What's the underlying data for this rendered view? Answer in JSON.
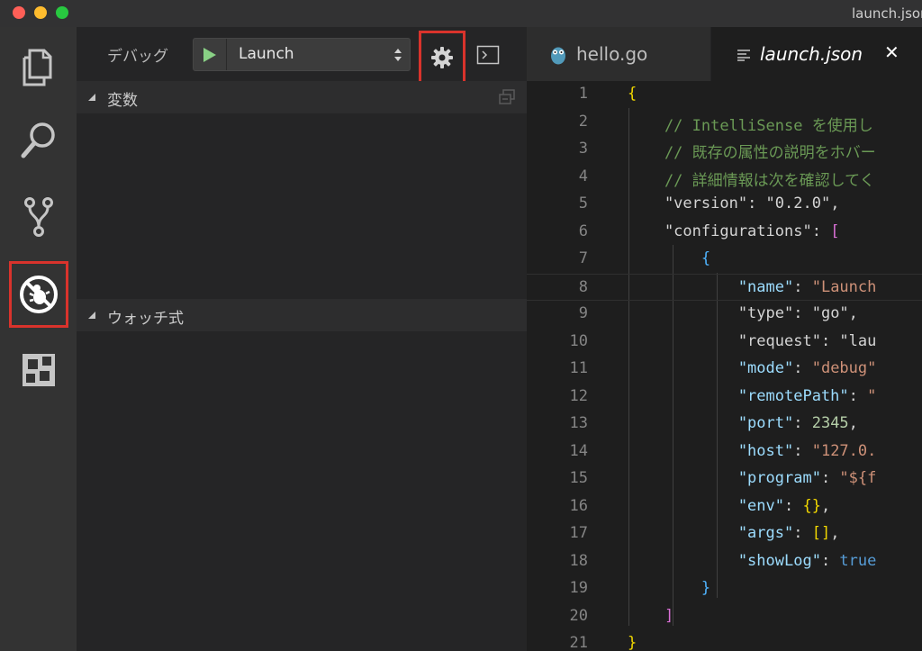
{
  "window": {
    "title": "launch.json"
  },
  "activity_bar": {
    "items": [
      {
        "name": "explorer-icon"
      },
      {
        "name": "search-icon"
      },
      {
        "name": "source-control-icon"
      },
      {
        "name": "debug-icon",
        "active": true
      },
      {
        "name": "extensions-icon"
      }
    ]
  },
  "debug_toolbar": {
    "label": "デバッグ",
    "config_value": "Launch"
  },
  "sections": {
    "variables": "変数",
    "watch": "ウォッチ式"
  },
  "tabs": [
    {
      "label": "hello.go"
    },
    {
      "label": "launch.json",
      "close": "✕"
    }
  ],
  "code_lines": [
    {
      "n": "1",
      "parts": [
        [
          "{",
          "c-brace1"
        ]
      ]
    },
    {
      "n": "2",
      "parts": [
        [
          "    // IntelliSense を使用し",
          "c-comment"
        ]
      ]
    },
    {
      "n": "3",
      "parts": [
        [
          "    // 既存の属性の説明をホバー",
          "c-comment"
        ]
      ]
    },
    {
      "n": "4",
      "parts": [
        [
          "    // 詳細情報は次を確認してく",
          "c-comment"
        ]
      ]
    },
    {
      "n": "5",
      "parts": [
        [
          "    \"version\"",
          "c-key2"
        ],
        [
          ": ",
          "c-punc"
        ],
        [
          "\"0.2.0\"",
          "c-key2"
        ],
        [
          ",",
          "c-punc"
        ]
      ]
    },
    {
      "n": "6",
      "parts": [
        [
          "    \"configurations\"",
          "c-key2"
        ],
        [
          ": ",
          "c-punc"
        ],
        [
          "[",
          "c-brace2"
        ]
      ]
    },
    {
      "n": "7",
      "parts": [
        [
          "        {",
          "c-brace3"
        ]
      ]
    },
    {
      "n": "8",
      "parts": [
        [
          "            \"name\"",
          "c-key"
        ],
        [
          ": ",
          "c-punc"
        ],
        [
          "\"Launch",
          "c-str"
        ]
      ]
    },
    {
      "n": "9",
      "parts": [
        [
          "            \"type\"",
          "c-key2"
        ],
        [
          ": ",
          "c-punc"
        ],
        [
          "\"go\"",
          "c-key2"
        ],
        [
          ",",
          "c-punc"
        ]
      ]
    },
    {
      "n": "10",
      "parts": [
        [
          "            \"request\"",
          "c-key2"
        ],
        [
          ": ",
          "c-punc"
        ],
        [
          "\"lau",
          "c-key2"
        ]
      ]
    },
    {
      "n": "11",
      "parts": [
        [
          "            \"mode\"",
          "c-key"
        ],
        [
          ": ",
          "c-punc"
        ],
        [
          "\"debug\"",
          "c-str"
        ]
      ]
    },
    {
      "n": "12",
      "parts": [
        [
          "            \"remotePath\"",
          "c-key"
        ],
        [
          ": ",
          "c-punc"
        ],
        [
          "\"",
          "c-str"
        ]
      ]
    },
    {
      "n": "13",
      "parts": [
        [
          "            \"port\"",
          "c-key"
        ],
        [
          ": ",
          "c-punc"
        ],
        [
          "2345",
          "c-num"
        ],
        [
          ",",
          "c-punc"
        ]
      ]
    },
    {
      "n": "14",
      "parts": [
        [
          "            \"host\"",
          "c-key"
        ],
        [
          ": ",
          "c-punc"
        ],
        [
          "\"127.0.",
          "c-str"
        ]
      ]
    },
    {
      "n": "15",
      "parts": [
        [
          "            \"program\"",
          "c-key"
        ],
        [
          ": ",
          "c-punc"
        ],
        [
          "\"${f",
          "c-str"
        ]
      ]
    },
    {
      "n": "16",
      "parts": [
        [
          "            \"env\"",
          "c-key"
        ],
        [
          ": ",
          "c-punc"
        ],
        [
          "{}",
          "c-brace1"
        ],
        [
          ",",
          "c-punc"
        ]
      ]
    },
    {
      "n": "17",
      "parts": [
        [
          "            \"args\"",
          "c-key"
        ],
        [
          ": ",
          "c-punc"
        ],
        [
          "[]",
          "c-brace1"
        ],
        [
          ",",
          "c-punc"
        ]
      ]
    },
    {
      "n": "18",
      "parts": [
        [
          "            \"showLog\"",
          "c-key"
        ],
        [
          ": ",
          "c-punc"
        ],
        [
          "true",
          "c-bool"
        ]
      ]
    },
    {
      "n": "19",
      "parts": [
        [
          "        }",
          "c-brace3"
        ]
      ]
    },
    {
      "n": "20",
      "parts": [
        [
          "    ]",
          "c-brace2"
        ]
      ]
    },
    {
      "n": "21",
      "parts": [
        [
          "}",
          "c-brace1"
        ]
      ]
    }
  ],
  "colors": {
    "highlight_border": "#d9332c",
    "play_green": "#89d185",
    "go_icon": "#519aba"
  }
}
